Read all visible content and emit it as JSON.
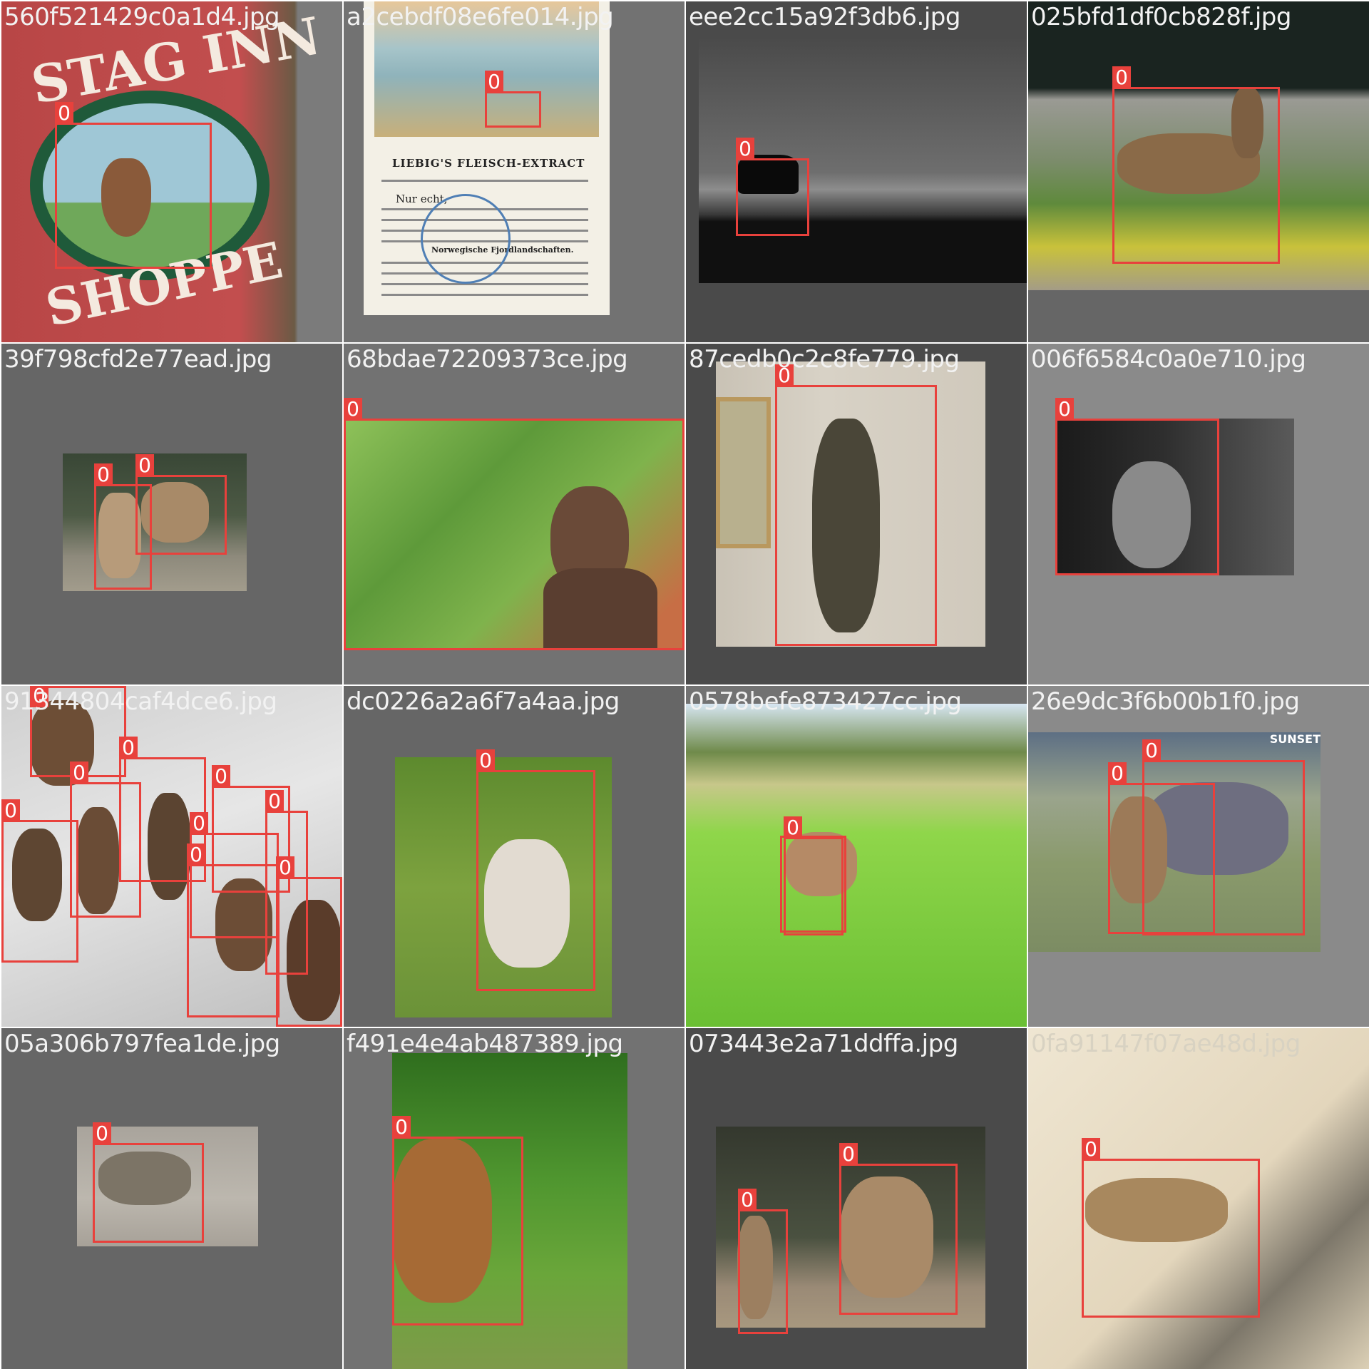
{
  "colors": {
    "box": "#e8413c",
    "tile_bg": "#727272",
    "filename_text": "#f2f2f2"
  },
  "mosaic": {
    "class_label": "0",
    "tiles": [
      {
        "filename": "560f521429c0a1d4.jpg",
        "sign_top": "STAG INN",
        "sign_bottom": "SHOPPE",
        "boxes": 1
      },
      {
        "filename": "a2cebdf08e6fe014.jpg",
        "doc_heading": "LIEBIG'S FLEISCH-EXTRACT",
        "doc_subheading": "Nur echt,",
        "doc_section": "Norwegische Fjordlandschaften.",
        "boxes": 1
      },
      {
        "filename": "eee2cc15a92f3db6.jpg",
        "boxes": 1
      },
      {
        "filename": "025bfd1df0cb828f.jpg",
        "boxes": 1
      },
      {
        "filename": "39f798cfd2e77ead.jpg",
        "boxes": 2
      },
      {
        "filename": "68bdae72209373ce.jpg",
        "boxes": 1
      },
      {
        "filename": "87cedb0c2c8fe779.jpg",
        "boxes": 1
      },
      {
        "filename": "006f6584c0a0e710.jpg",
        "boxes": 1
      },
      {
        "filename": "91344804caf4dce6.jpg",
        "boxes": 9
      },
      {
        "filename": "dc0226a2a6f7a4aa.jpg",
        "boxes": 1
      },
      {
        "filename": "0578befe873427cc.jpg",
        "boxes": 2
      },
      {
        "filename": "26e9dc3f6b00b1f0.jpg",
        "sign_label": "SUNSET",
        "boxes": 2
      },
      {
        "filename": "05a306b797fea1de.jpg",
        "boxes": 1
      },
      {
        "filename": "f491e4e4ab487389.jpg",
        "boxes": 1
      },
      {
        "filename": "073443e2a71ddffa.jpg",
        "boxes": 2
      },
      {
        "filename": "0fa91147f07ae48d.jpg",
        "boxes": 1
      }
    ]
  }
}
